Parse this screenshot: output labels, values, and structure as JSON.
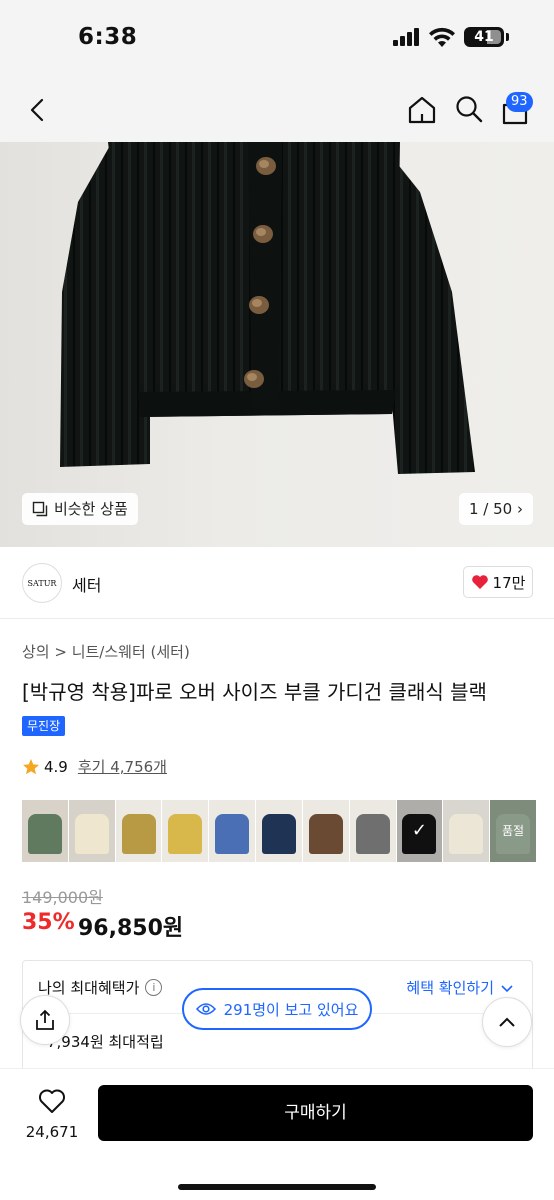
{
  "status_bar": {
    "time": "6:38",
    "battery": "41"
  },
  "nav": {
    "cart_count": "93"
  },
  "hero": {
    "similar_label": "비슷한 상품",
    "counter": "1 / 50"
  },
  "store": {
    "logo_text": "SATUR",
    "name": "세터",
    "likes": "17만"
  },
  "product": {
    "breadcrumb": "상의 > 니트/스웨터 (세터)",
    "title": "[박규영 착용]파로 오버 사이즈 부클 가디건 클래식 블랙",
    "tag": "무진장",
    "rating": "4.9",
    "reviews": "후기 4,756개",
    "original_price": "149,000원",
    "discount": "35%",
    "price": "96,850원"
  },
  "swatches": [
    {
      "name": "model-green",
      "color": "#5f7a5e",
      "bg": "#d9d2c8"
    },
    {
      "name": "model-cream",
      "color": "#efe6cf",
      "bg": "#d6d1c9"
    },
    {
      "name": "mustard",
      "color": "#b89a44",
      "bg": "#ece9e2"
    },
    {
      "name": "yellow",
      "color": "#d8b84a",
      "bg": "#ece9e2"
    },
    {
      "name": "blue",
      "color": "#4a6fb5",
      "bg": "#ece9e2"
    },
    {
      "name": "navy",
      "color": "#1f3355",
      "bg": "#ece9e2"
    },
    {
      "name": "brown",
      "color": "#6b4a33",
      "bg": "#ece9e2"
    },
    {
      "name": "grey",
      "color": "#6f6f6f",
      "bg": "#ece9e2"
    },
    {
      "name": "black",
      "color": "#161616",
      "bg": "#e9e7e3",
      "selected": true,
      "check": "✓"
    },
    {
      "name": "ivory",
      "color": "#ece6d6",
      "bg": "#d9d6cf"
    },
    {
      "name": "sage",
      "color": "#8a9a88",
      "bg": "#7e8c7c",
      "soldout_label": "품절"
    }
  ],
  "benefit": {
    "title": "나의 최대혜택가",
    "info": "i",
    "link": "혜택 확인하기",
    "points": "7,934원 최대적립"
  },
  "viewers": "291명이 보고 있어요",
  "bottom": {
    "wish_count": "24,671",
    "buy_label": "구매하기"
  },
  "colors": {
    "accent": "#1e66ff",
    "discount": "#ee2a2a",
    "heart": "#e8223a"
  }
}
